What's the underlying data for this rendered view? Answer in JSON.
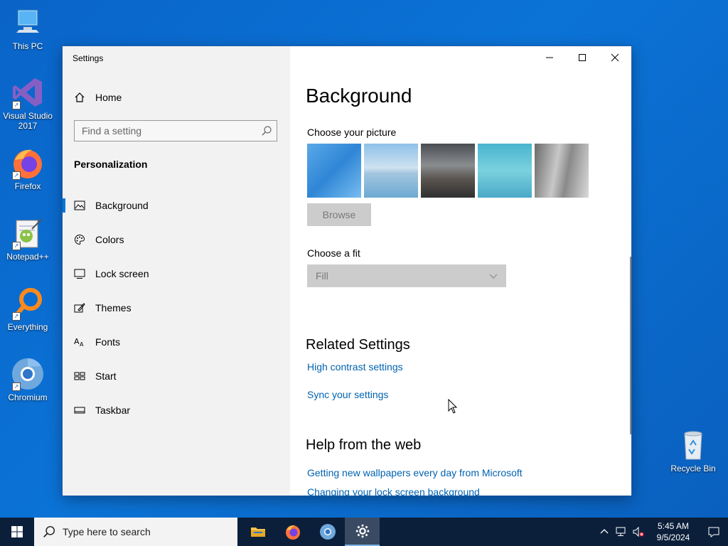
{
  "desktop": {
    "icons": [
      {
        "label": "This PC"
      },
      {
        "label": "Visual Studio 2017"
      },
      {
        "label": "Firefox"
      },
      {
        "label": "Notepad++"
      },
      {
        "label": "Everything"
      },
      {
        "label": "Chromium"
      },
      {
        "label": "Recycle Bin"
      }
    ]
  },
  "window": {
    "title": "Settings",
    "home_label": "Home",
    "search_placeholder": "Find a setting",
    "section": "Personalization",
    "nav": [
      {
        "label": "Background",
        "icon": "picture-icon",
        "selected": true
      },
      {
        "label": "Colors",
        "icon": "palette-icon"
      },
      {
        "label": "Lock screen",
        "icon": "lock-screen-icon"
      },
      {
        "label": "Themes",
        "icon": "themes-icon"
      },
      {
        "label": "Fonts",
        "icon": "fonts-icon"
      },
      {
        "label": "Start",
        "icon": "start-icon"
      },
      {
        "label": "Taskbar",
        "icon": "taskbar-icon"
      }
    ]
  },
  "content": {
    "title": "Background",
    "choose_picture": "Choose your picture",
    "browse_label": "Browse",
    "choose_fit": "Choose a fit",
    "fit_value": "Fill",
    "related_title": "Related Settings",
    "related_links": [
      "High contrast settings",
      "Sync your settings"
    ],
    "help_title": "Help from the web",
    "help_links": [
      "Getting new wallpapers every day from Microsoft",
      "Changing your lock screen background"
    ]
  },
  "taskbar": {
    "search_placeholder": "Type here to search",
    "time": "5:45 AM",
    "date": "9/5/2024"
  },
  "colors": {
    "accent": "#0078d7",
    "link": "#0063b1",
    "taskbar": "#0b1f3b"
  }
}
